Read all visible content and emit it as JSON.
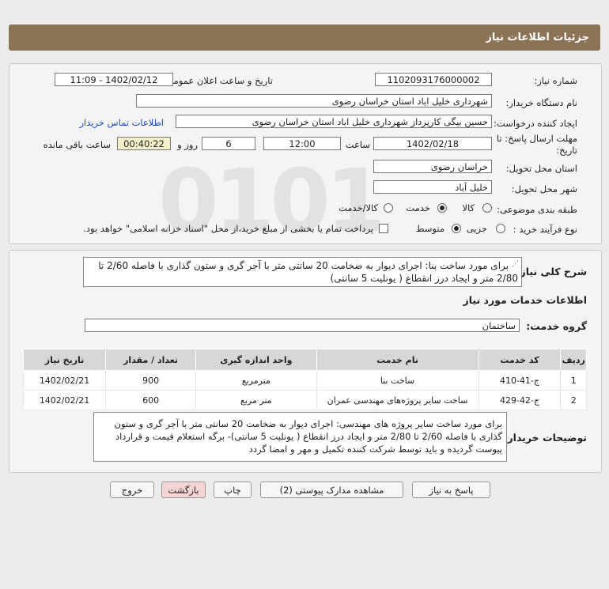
{
  "header": {
    "title": "جزئیات اطلاعات نیاز"
  },
  "form": {
    "need_number_label": "شماره نیاز:",
    "need_number": "1102093176000002",
    "announce_label": "تاریخ و ساعت اعلان عمومی:",
    "announce_value": "1402/02/12 - 11:09",
    "buyer_org_label": "نام دستگاه خریدار:",
    "buyer_org": "شهرداری خلیل اباد استان خراسان رضوی",
    "creator_label": "ایجاد کننده درخواست:",
    "creator": "حسین بیگی کارپرداز شهرداری خلیل اباد استان خراسان رضوی",
    "contact_link": "اطلاعات تماس خریدار",
    "deadline_label_1": "مهلت ارسال پاسخ: تا",
    "deadline_label_2": "تاریخ:",
    "deadline_date": "1402/02/18",
    "time_label": "ساعت",
    "deadline_time": "12:00",
    "days_value": "6",
    "days_label": "روز و",
    "remaining_time": "00:40:22",
    "remaining_label": "ساعت باقی مانده",
    "province_label": "استان محل تحویل:",
    "province": "خراسان رضوی",
    "city_label": "شهر محل تحویل:",
    "city": "خلیل آباد",
    "category_label": "طبقه بندی موضوعی:",
    "category_options": [
      "کالا",
      "خدمت",
      "کالا/خدمت"
    ],
    "category_selected": "خدمت",
    "process_label": "نوع فرآیند خرید :",
    "process_options": [
      "جزیی",
      "متوسط"
    ],
    "process_selected": "متوسط",
    "treasury_note": "پرداخت تمام یا بخشی از مبلغ خرید،از محل \"اسناد خزانه اسلامی\" خواهد بود."
  },
  "details": {
    "summary_label": "شرح کلی نیاز:",
    "summary_line1": "برای  مورد ساخت بنا: اجرای دیوار به ضخامت 20 سانتی متر با آجر گری و ستون گذاری با فاصله 2/60 تا",
    "summary_line2": "2/80 متر و ایجاد درز انقطاع ( یونلیت 5 سانتی)",
    "services_heading": "اطلاعات خدمات مورد نیاز",
    "service_group_label": "گروه خدمت:",
    "service_group": "ساختمان",
    "table_headers": [
      "ردیف",
      "کد خدمت",
      "نام خدمت",
      "واحد اندازه گیری",
      "تعداد / مقدار",
      "تاریخ نیاز"
    ],
    "rows": [
      [
        "1",
        "ج-41-410",
        "ساخت بنا",
        "مترمربع",
        "900",
        "1402/02/21"
      ],
      [
        "2",
        "ج-42-429",
        "ساخت سایر پروژه‌های مهندسی عمران",
        "متر مربع",
        "600",
        "1402/02/21"
      ]
    ],
    "buyer_notes_label": "توضیحات خریدار:",
    "buyer_notes_lines": [
      "برای مورد ساخت سایر پروژه های مهندسی: اجرای دیوار به ضخامت 20 سانتی متر با آجر گری و ستون",
      "گذاری با فاصله 2/60 تا 2/80 متر و ایجاد درز انقطاع ( یونلیت 5 سانتی)- برگه استعلام قیمت و قرارداد",
      "پیوست گردیده و  باید توسط شرکت کننده تکمیل و مهر و امضا گردد"
    ]
  },
  "buttons": {
    "reply": "پاسخ به نیاز",
    "attachments": "مشاهده مدارک پیوستی (2)",
    "print": "چاپ",
    "back": "بازگشت",
    "exit": "خروج"
  },
  "colors": {
    "header_bg": "#8d7356",
    "link": "#1a4bb5",
    "exit_bg": "#f5d4d4"
  }
}
